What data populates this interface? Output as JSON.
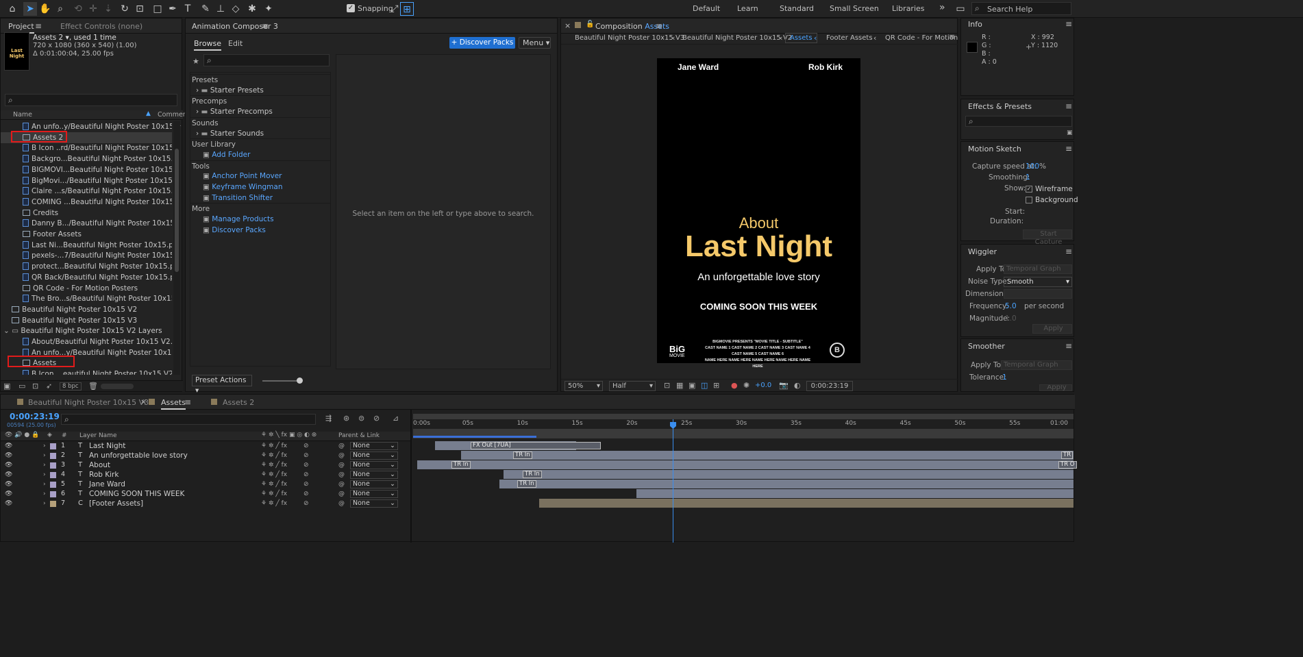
{
  "toolbar": {
    "snapping": "Snapping",
    "workspaces": [
      "Default",
      "Learn",
      "Standard",
      "Small Screen",
      "Libraries"
    ],
    "search_placeholder": "Search Help",
    "more": "»"
  },
  "project": {
    "tab": "Project",
    "tab2": "Effect Controls (none)",
    "item_name": "Assets 2",
    "used": ", used 1 time",
    "size": "720 x 1080  (360 x 540) (1.00)",
    "duration": "Δ 0:01:00:04, 25.00 fps",
    "thumb_title": "Last Night",
    "col_name": "Name",
    "col_comment": "Comment",
    "rows": [
      {
        "name": "An unfo..y/Beautiful Night Poster 10x15.psd",
        "type": "psd",
        "indent": 2
      },
      {
        "name": "Assets 2",
        "type": "comp",
        "indent": 2
      },
      {
        "name": "B Icon ..rd/Beautiful Night Poster 10x15.psd",
        "type": "psd",
        "indent": 2
      },
      {
        "name": "Backgro...Beautiful Night Poster 10x15.psd",
        "type": "psd",
        "indent": 2
      },
      {
        "name": "BIGMOVI...Beautiful Night Poster 10x15.psd",
        "type": "psd",
        "indent": 2
      },
      {
        "name": "BigMovi.../Beautiful Night Poster 10x15.psd",
        "type": "psd",
        "indent": 2
      },
      {
        "name": "Claire ...s/Beautiful Night Poster 10x15.psd",
        "type": "psd",
        "indent": 2
      },
      {
        "name": "COMING ...Beautiful Night Poster 10x15.psd",
        "type": "psd",
        "indent": 2
      },
      {
        "name": "Credits",
        "type": "comp",
        "indent": 2
      },
      {
        "name": "Danny B.../Beautiful Night Poster 10x15.psd",
        "type": "psd",
        "indent": 2
      },
      {
        "name": "Footer Assets",
        "type": "comp",
        "indent": 2
      },
      {
        "name": "Last Ni...Beautiful Night Poster 10x15.psd",
        "type": "psd",
        "indent": 2
      },
      {
        "name": "pexels-...7/Beautiful Night Poster 10x15.psd",
        "type": "psd",
        "indent": 2
      },
      {
        "name": "protect...Beautiful Night Poster 10x15.psd",
        "type": "psd",
        "indent": 2
      },
      {
        "name": "QR Back/Beautiful Night Poster 10x15.psd",
        "type": "psd",
        "indent": 2
      },
      {
        "name": "QR Code - For Motion Posters",
        "type": "comp",
        "indent": 2
      },
      {
        "name": "The Bro...s/Beautiful Night Poster 10x15.psd",
        "type": "psd",
        "indent": 2
      },
      {
        "name": "Beautiful Night Poster 10x15 V2",
        "type": "comp",
        "indent": 1
      },
      {
        "name": "Beautiful Night Poster 10x15 V3",
        "type": "comp",
        "indent": 1
      },
      {
        "name": "Beautiful Night Poster 10x15 V2 Layers",
        "type": "folder",
        "indent": 0
      },
      {
        "name": "About/Beautiful Night Poster 10x15 V2.psd",
        "type": "psd",
        "indent": 2
      },
      {
        "name": "An unfo...y/Beautiful Night Poster 10x15 V2.psd",
        "type": "psd",
        "indent": 2
      },
      {
        "name": "Assets",
        "type": "comp",
        "indent": 2
      },
      {
        "name": "B Icon ...eautiful Night Poster 10x15 V2.psd",
        "type": "psd",
        "indent": 2
      }
    ],
    "bpc": "8 bpc"
  },
  "composer": {
    "title": "Animation Composer 3",
    "tab_browse": "Browse",
    "tab_edit": "Edit",
    "discover": "Discover Packs",
    "menu": "Menu",
    "tree": [
      {
        "label": "Presets",
        "kind": "section"
      },
      {
        "label": "Starter Presets",
        "kind": "folder"
      },
      {
        "label": "Precomps",
        "kind": "section"
      },
      {
        "label": "Starter Precomps",
        "kind": "folder"
      },
      {
        "label": "Sounds",
        "kind": "section"
      },
      {
        "label": "Starter Sounds",
        "kind": "folder"
      },
      {
        "label": "User Library",
        "kind": "section"
      },
      {
        "label": "Add Folder",
        "kind": "link"
      },
      {
        "label": "Tools",
        "kind": "section"
      },
      {
        "label": "Anchor Point Mover",
        "kind": "link"
      },
      {
        "label": "Keyframe Wingman",
        "kind": "link"
      },
      {
        "label": "Transition Shifter",
        "kind": "link"
      },
      {
        "label": "More",
        "kind": "section"
      },
      {
        "label": "Manage Products",
        "kind": "link"
      },
      {
        "label": "Discover Packs",
        "kind": "link"
      }
    ],
    "empty_msg": "Select an item on the left or type above to search.",
    "preset_actions": "Preset Actions"
  },
  "viewer": {
    "tab_prefix": "Composition",
    "tab_name": "Assets",
    "crumbs": [
      "Beautiful Night Poster 10x15 V3",
      "Beautiful Night Poster 10x15 V2",
      "Assets",
      "Footer Assets",
      "QR Code - For Motion"
    ],
    "poster": {
      "left_name": "Jane Ward",
      "right_name": "Rob Kirk",
      "about": "About",
      "title": "Last Night",
      "subtitle": "An unforgettable love story",
      "coming": "COMING SOON THIS WEEK",
      "logo_big": "BiG",
      "logo_movie": "MOVIE",
      "credits1": "BIGMOVIE PRESENTS \"MOVIE TITLE - SUBTITLE\"",
      "credits2": "CAST NAME 1  CAST NAME 2  CAST NAME 3  CAST NAME 4  CAST NAME 5  CAST NAME 6",
      "credits3": "NAME HERE  NAME HERE  NAME HERE  NAME HERE  NAME HERE",
      "title_color": "#f5c96a"
    },
    "zoom": "50%",
    "res": "Half",
    "exposure": "+0.0",
    "time": "0:00:23:19"
  },
  "info": {
    "title": "Info",
    "r": "R :",
    "g": "G :",
    "b": "B :",
    "a": "A :  0",
    "x": "X : 992",
    "y": "Y : 1120"
  },
  "effects": {
    "title": "Effects & Presets"
  },
  "motion": {
    "title": "Motion Sketch",
    "capture_label": "Capture speed at:",
    "capture_val": "100",
    "capture_unit": "%",
    "smoothing_label": "Smoothing:",
    "smoothing_val": "1",
    "show_label": "Show:",
    "wireframe": "Wireframe",
    "background": "Background",
    "start": "Start:",
    "duration": "Duration:",
    "start_btn": "Start Capture"
  },
  "wiggler": {
    "title": "Wiggler",
    "apply_label": "Apply To:",
    "apply_val": "Temporal Graph",
    "noise_label": "Noise Type:",
    "noise_val": "Smooth",
    "dims_label": "Dimensions:",
    "freq_label": "Frequency:",
    "freq_val": "5.0",
    "freq_unit": "per second",
    "mag_label": "Magnitude:",
    "mag_val": "1.0",
    "apply_btn": "Apply"
  },
  "smoother": {
    "title": "Smoother",
    "apply_label": "Apply To:",
    "apply_val": "Temporal Graph",
    "tol_label": "Tolerance:",
    "tol_val": "1",
    "apply_btn": "Apply"
  },
  "timeline": {
    "tabs": [
      "Beautiful Night Poster 10x15 V3",
      "Assets",
      "Assets 2"
    ],
    "timecode": "0:00:23:19",
    "frames": "00594 (25.00 fps)",
    "col_layer": "Layer Name",
    "col_parent": "Parent & Link",
    "ruler": [
      "0:00s",
      "05s",
      "10s",
      "15s",
      "20s",
      "25s",
      "30s",
      "35s",
      "40s",
      "45s",
      "50s",
      "55s",
      "01:00"
    ],
    "layers": [
      {
        "num": "1",
        "name": "Last Night",
        "type": "T",
        "parent": "None",
        "kf": "FX Out [7UA]"
      },
      {
        "num": "2",
        "name": "An unforgettable love story",
        "type": "T",
        "parent": "None",
        "kf": "TR In"
      },
      {
        "num": "3",
        "name": "About",
        "type": "T",
        "parent": "None",
        "kf": "TR In"
      },
      {
        "num": "4",
        "name": "Rob Kirk",
        "type": "T",
        "parent": "None",
        "kf": "TR In"
      },
      {
        "num": "5",
        "name": "Jane Ward",
        "type": "T",
        "parent": "None",
        "kf": "TR In"
      },
      {
        "num": "6",
        "name": "COMING SOON THIS WEEK",
        "type": "T",
        "parent": "None",
        "kf": ""
      },
      {
        "num": "7",
        "name": "[Footer Assets]",
        "type": "C",
        "parent": "None",
        "kf": ""
      }
    ],
    "end_kf1": "TR",
    "end_kf2": "TR O"
  }
}
